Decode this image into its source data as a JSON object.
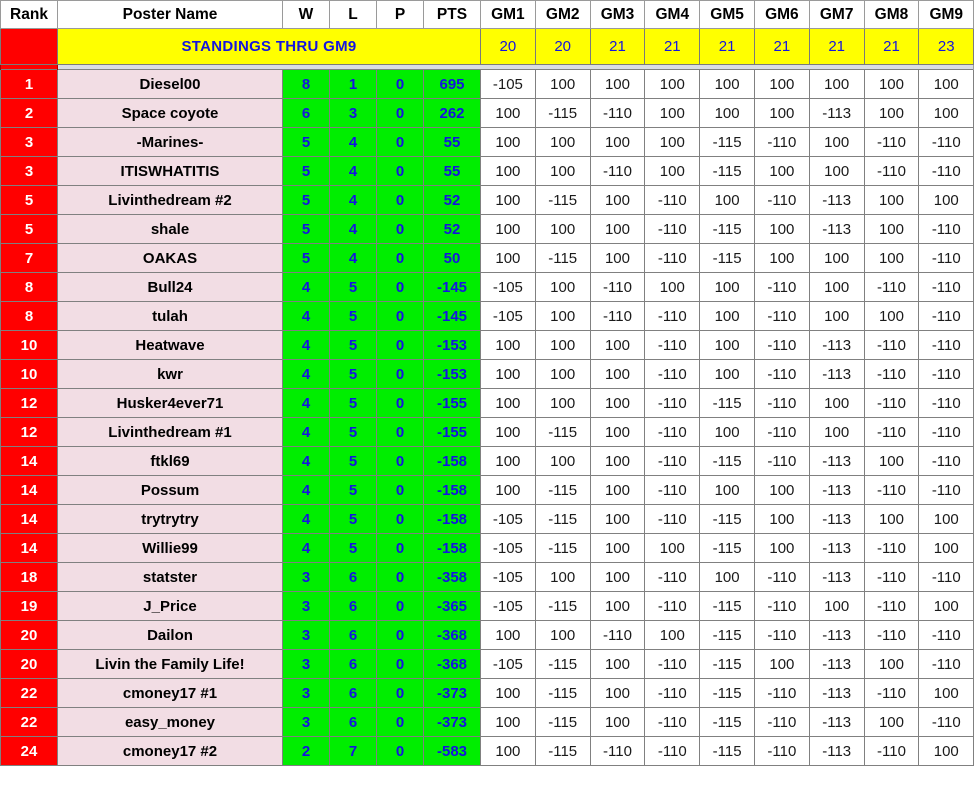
{
  "table": {
    "columns": [
      "Rank",
      "Poster Name",
      "W",
      "L",
      "P",
      "PTS",
      "GM1",
      "GM2",
      "GM3",
      "GM4",
      "GM5",
      "GM6",
      "GM7",
      "GM8",
      "GM9"
    ],
    "banner": {
      "title": "STANDINGS THRU GM9",
      "gm_counts": [
        "20",
        "20",
        "21",
        "21",
        "21",
        "21",
        "21",
        "21",
        "23"
      ]
    },
    "colors": {
      "rank_bg": "#ff0000",
      "rank_text": "#ffffff",
      "name_bg": "#f2dde4",
      "stat_bg": "#00ee00",
      "stat_text": "#1414e0",
      "banner_bg": "#ffff00",
      "banner_text": "#1414e0",
      "gm_bg": "#ffffff",
      "grid": "#808080"
    },
    "rows": [
      {
        "rank": "1",
        "name": "Diesel00",
        "w": "8",
        "l": "1",
        "p": "0",
        "pts": "695",
        "gms": [
          "-105",
          "100",
          "100",
          "100",
          "100",
          "100",
          "100",
          "100",
          "100"
        ]
      },
      {
        "rank": "2",
        "name": "Space coyote",
        "w": "6",
        "l": "3",
        "p": "0",
        "pts": "262",
        "gms": [
          "100",
          "-115",
          "-110",
          "100",
          "100",
          "100",
          "-113",
          "100",
          "100"
        ]
      },
      {
        "rank": "3",
        "name": "-Marines-",
        "w": "5",
        "l": "4",
        "p": "0",
        "pts": "55",
        "gms": [
          "100",
          "100",
          "100",
          "100",
          "-115",
          "-110",
          "100",
          "-110",
          "-110"
        ]
      },
      {
        "rank": "3",
        "name": "ITISWHATITIS",
        "w": "5",
        "l": "4",
        "p": "0",
        "pts": "55",
        "gms": [
          "100",
          "100",
          "-110",
          "100",
          "-115",
          "100",
          "100",
          "-110",
          "-110"
        ]
      },
      {
        "rank": "5",
        "name": "Livinthedream #2",
        "w": "5",
        "l": "4",
        "p": "0",
        "pts": "52",
        "gms": [
          "100",
          "-115",
          "100",
          "-110",
          "100",
          "-110",
          "-113",
          "100",
          "100"
        ]
      },
      {
        "rank": "5",
        "name": "shale",
        "w": "5",
        "l": "4",
        "p": "0",
        "pts": "52",
        "gms": [
          "100",
          "100",
          "100",
          "-110",
          "-115",
          "100",
          "-113",
          "100",
          "-110"
        ]
      },
      {
        "rank": "7",
        "name": "OAKAS",
        "w": "5",
        "l": "4",
        "p": "0",
        "pts": "50",
        "gms": [
          "100",
          "-115",
          "100",
          "-110",
          "-115",
          "100",
          "100",
          "100",
          "-110"
        ]
      },
      {
        "rank": "8",
        "name": "Bull24",
        "w": "4",
        "l": "5",
        "p": "0",
        "pts": "-145",
        "gms": [
          "-105",
          "100",
          "-110",
          "100",
          "100",
          "-110",
          "100",
          "-110",
          "-110"
        ]
      },
      {
        "rank": "8",
        "name": "tulah",
        "w": "4",
        "l": "5",
        "p": "0",
        "pts": "-145",
        "gms": [
          "-105",
          "100",
          "-110",
          "-110",
          "100",
          "-110",
          "100",
          "100",
          "-110"
        ]
      },
      {
        "rank": "10",
        "name": "Heatwave",
        "w": "4",
        "l": "5",
        "p": "0",
        "pts": "-153",
        "gms": [
          "100",
          "100",
          "100",
          "-110",
          "100",
          "-110",
          "-113",
          "-110",
          "-110"
        ]
      },
      {
        "rank": "10",
        "name": "kwr",
        "w": "4",
        "l": "5",
        "p": "0",
        "pts": "-153",
        "gms": [
          "100",
          "100",
          "100",
          "-110",
          "100",
          "-110",
          "-113",
          "-110",
          "-110"
        ]
      },
      {
        "rank": "12",
        "name": "Husker4ever71",
        "w": "4",
        "l": "5",
        "p": "0",
        "pts": "-155",
        "gms": [
          "100",
          "100",
          "100",
          "-110",
          "-115",
          "-110",
          "100",
          "-110",
          "-110"
        ]
      },
      {
        "rank": "12",
        "name": "Livinthedream #1",
        "w": "4",
        "l": "5",
        "p": "0",
        "pts": "-155",
        "gms": [
          "100",
          "-115",
          "100",
          "-110",
          "100",
          "-110",
          "100",
          "-110",
          "-110"
        ]
      },
      {
        "rank": "14",
        "name": "ftkl69",
        "w": "4",
        "l": "5",
        "p": "0",
        "pts": "-158",
        "gms": [
          "100",
          "100",
          "100",
          "-110",
          "-115",
          "-110",
          "-113",
          "100",
          "-110"
        ]
      },
      {
        "rank": "14",
        "name": "Possum",
        "w": "4",
        "l": "5",
        "p": "0",
        "pts": "-158",
        "gms": [
          "100",
          "-115",
          "100",
          "-110",
          "100",
          "100",
          "-113",
          "-110",
          "-110"
        ]
      },
      {
        "rank": "14",
        "name": "trytrytry",
        "w": "4",
        "l": "5",
        "p": "0",
        "pts": "-158",
        "gms": [
          "-105",
          "-115",
          "100",
          "-110",
          "-115",
          "100",
          "-113",
          "100",
          "100"
        ]
      },
      {
        "rank": "14",
        "name": "Willie99",
        "w": "4",
        "l": "5",
        "p": "0",
        "pts": "-158",
        "gms": [
          "-105",
          "-115",
          "100",
          "100",
          "-115",
          "100",
          "-113",
          "-110",
          "100"
        ]
      },
      {
        "rank": "18",
        "name": "statster",
        "w": "3",
        "l": "6",
        "p": "0",
        "pts": "-358",
        "gms": [
          "-105",
          "100",
          "100",
          "-110",
          "100",
          "-110",
          "-113",
          "-110",
          "-110"
        ]
      },
      {
        "rank": "19",
        "name": "J_Price",
        "w": "3",
        "l": "6",
        "p": "0",
        "pts": "-365",
        "gms": [
          "-105",
          "-115",
          "100",
          "-110",
          "-115",
          "-110",
          "100",
          "-110",
          "100"
        ]
      },
      {
        "rank": "20",
        "name": "Dailon",
        "w": "3",
        "l": "6",
        "p": "0",
        "pts": "-368",
        "gms": [
          "100",
          "100",
          "-110",
          "100",
          "-115",
          "-110",
          "-113",
          "-110",
          "-110"
        ]
      },
      {
        "rank": "20",
        "name": "Livin the Family Life!",
        "w": "3",
        "l": "6",
        "p": "0",
        "pts": "-368",
        "gms": [
          "-105",
          "-115",
          "100",
          "-110",
          "-115",
          "100",
          "-113",
          "100",
          "-110"
        ]
      },
      {
        "rank": "22",
        "name": "cmoney17 #1",
        "w": "3",
        "l": "6",
        "p": "0",
        "pts": "-373",
        "gms": [
          "100",
          "-115",
          "100",
          "-110",
          "-115",
          "-110",
          "-113",
          "-110",
          "100"
        ]
      },
      {
        "rank": "22",
        "name": "easy_money",
        "w": "3",
        "l": "6",
        "p": "0",
        "pts": "-373",
        "gms": [
          "100",
          "-115",
          "100",
          "-110",
          "-115",
          "-110",
          "-113",
          "100",
          "-110"
        ]
      },
      {
        "rank": "24",
        "name": "cmoney17 #2",
        "w": "2",
        "l": "7",
        "p": "0",
        "pts": "-583",
        "gms": [
          "100",
          "-115",
          "-110",
          "-110",
          "-115",
          "-110",
          "-113",
          "-110",
          "100"
        ]
      }
    ]
  }
}
